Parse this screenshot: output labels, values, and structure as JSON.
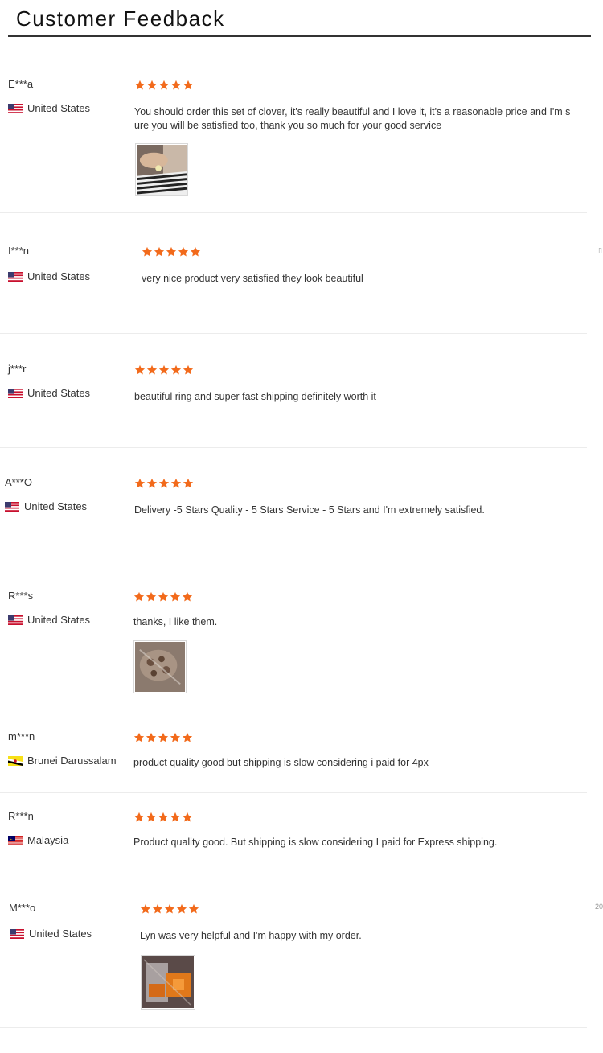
{
  "header": {
    "title": "Customer Feedback"
  },
  "colors": {
    "star": "#f26a1b",
    "text": "#333333",
    "rule": "#333333"
  },
  "reviews": [
    {
      "name": "E***a",
      "country": "United States",
      "flag": "us",
      "rating": 5,
      "comment": "You should order this set of clover, it's really beautiful and I love it, it's a reasonable price and I'm s ure you will be satisfied too, thank you so much for your good service",
      "photo": "zebra-jewelry-photo"
    },
    {
      "name": "I***n",
      "country": "United States",
      "flag": "us",
      "rating": 5,
      "comment": "very nice product very satisfied they look beautiful",
      "photo": null
    },
    {
      "name": "j***r",
      "country": "United States",
      "flag": "us",
      "rating": 5,
      "comment": "beautiful ring and super fast shipping definitely worth it",
      "photo": null
    },
    {
      "name": "A***O",
      "country": "United States",
      "flag": "us",
      "rating": 5,
      "comment": "Delivery -5 Stars Quality - 5 Stars Service - 5 Stars and I'm extremely satisfied.",
      "photo": null
    },
    {
      "name": "R***s",
      "country": "United States",
      "flag": "us",
      "rating": 5,
      "comment": "thanks, I like them.",
      "photo": "package-photo"
    },
    {
      "name": "m***n",
      "country": "Brunei Darussalam",
      "flag": "bn",
      "rating": 5,
      "comment": "product quality good but shipping is slow considering i paid for 4px",
      "photo": null
    },
    {
      "name": "R***n",
      "country": "Malaysia",
      "flag": "my",
      "rating": 5,
      "comment": "Product quality good. But shipping is slow considering I paid for Express shipping.",
      "photo": null
    },
    {
      "name": "M***o",
      "country": "United States",
      "flag": "us",
      "rating": 5,
      "comment": "Lyn was very helpful and I'm happy with my order.",
      "photo": "orange-package-photo"
    }
  ],
  "edge_marks": {
    "mark_1": "▯",
    "mark_2": "20"
  }
}
